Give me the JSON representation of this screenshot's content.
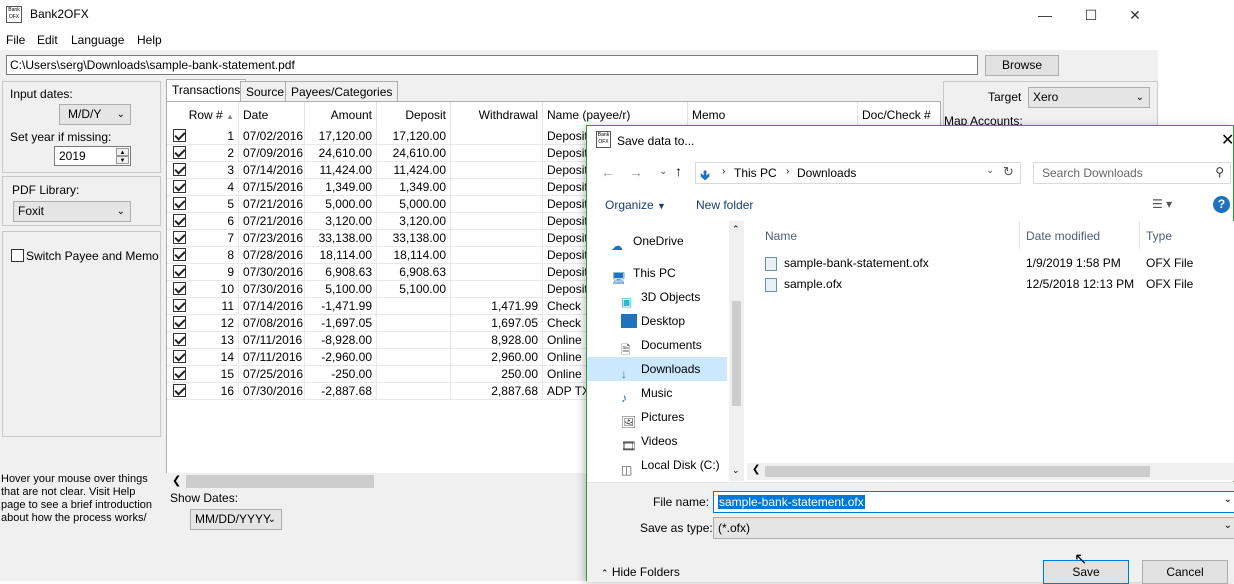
{
  "window": {
    "title": "Bank2OFX",
    "icon_text": "Bank OFX"
  },
  "menu": [
    "File",
    "Edit",
    "Language",
    "Help"
  ],
  "file_path": "C:\\Users\\serg\\Downloads\\sample-bank-statement.pdf",
  "browse_label": "Browse",
  "left": {
    "input_dates_label": "Input dates:",
    "input_dates_value": "M/D/Y",
    "year_label": "Set year if missing:",
    "year_value": "2019",
    "pdf_label": "PDF Library:",
    "pdf_value": "Foxit",
    "switch_label": "Switch Payee and Memo",
    "hint": "Hover your mouse over things that are not clear. Visit Help page to see a brief introduction about how the process works/",
    "show_dates_label": "Show Dates:",
    "show_dates_value": "MM/DD/YYYY"
  },
  "tabs": [
    "Transactions",
    "Source",
    "Payees/Categories"
  ],
  "columns": [
    "Row #",
    "Date",
    "Amount",
    "Deposit",
    "Withdrawal",
    "Name (payee/r)",
    "Memo",
    "Doc/Check #"
  ],
  "rows": [
    [
      "1",
      "07/02/2016",
      "17,120.00",
      "17,120.00",
      "",
      "Deposit"
    ],
    [
      "2",
      "07/09/2016",
      "24,610.00",
      "24,610.00",
      "",
      "Deposit"
    ],
    [
      "3",
      "07/14/2016",
      "11,424.00",
      "11,424.00",
      "",
      "Deposit"
    ],
    [
      "4",
      "07/15/2016",
      "1,349.00",
      "1,349.00",
      "",
      "Deposit"
    ],
    [
      "5",
      "07/21/2016",
      "5,000.00",
      "5,000.00",
      "",
      "Deposit"
    ],
    [
      "6",
      "07/21/2016",
      "3,120.00",
      "3,120.00",
      "",
      "Deposit"
    ],
    [
      "7",
      "07/23/2016",
      "33,138.00",
      "33,138.00",
      "",
      "Deposit"
    ],
    [
      "8",
      "07/28/2016",
      "18,114.00",
      "18,114.00",
      "",
      "Deposit"
    ],
    [
      "9",
      "07/30/2016",
      "6,908.63",
      "6,908.63",
      "",
      "Deposit"
    ],
    [
      "10",
      "07/30/2016",
      "5,100.00",
      "5,100.00",
      "",
      "Deposit"
    ],
    [
      "11",
      "07/14/2016",
      "-1,471.99",
      "",
      "1,471.99",
      "Check"
    ],
    [
      "12",
      "07/08/2016",
      "-1,697.05",
      "",
      "1,697.05",
      "Check"
    ],
    [
      "13",
      "07/11/2016",
      "-8,928.00",
      "",
      "8,928.00",
      "Online P"
    ],
    [
      "14",
      "07/11/2016",
      "-2,960.00",
      "",
      "2,960.00",
      "Online P"
    ],
    [
      "15",
      "07/25/2016",
      "-250.00",
      "",
      "250.00",
      "Online P"
    ],
    [
      "16",
      "07/30/2016",
      "-2,887.68",
      "",
      "2,887.68",
      "ADP TX/"
    ]
  ],
  "target": {
    "label": "Target",
    "value": "Xero",
    "map_label": "Map Accounts:"
  },
  "dialog": {
    "title": "Save data to...",
    "breadcrumb": [
      "This PC",
      "Downloads"
    ],
    "search_placeholder": "Search Downloads",
    "organize": "Organize",
    "new_folder": "New folder",
    "nav": [
      "OneDrive",
      "This PC",
      "3D Objects",
      "Desktop",
      "Documents",
      "Downloads",
      "Music",
      "Pictures",
      "Videos",
      "Local Disk (C:)"
    ],
    "file_columns": [
      "Name",
      "Date modified",
      "Type"
    ],
    "files": [
      {
        "name": "sample-bank-statement.ofx",
        "date": "1/9/2019 1:58 PM",
        "type": "OFX File"
      },
      {
        "name": "sample.ofx",
        "date": "12/5/2018 12:13 PM",
        "type": "OFX File"
      }
    ],
    "filename_label": "File name:",
    "filename_value": "sample-bank-statement.ofx",
    "savetype_label": "Save as type:",
    "savetype_value": "(*.ofx)",
    "hide_folders": "Hide Folders",
    "save": "Save",
    "cancel": "Cancel"
  }
}
